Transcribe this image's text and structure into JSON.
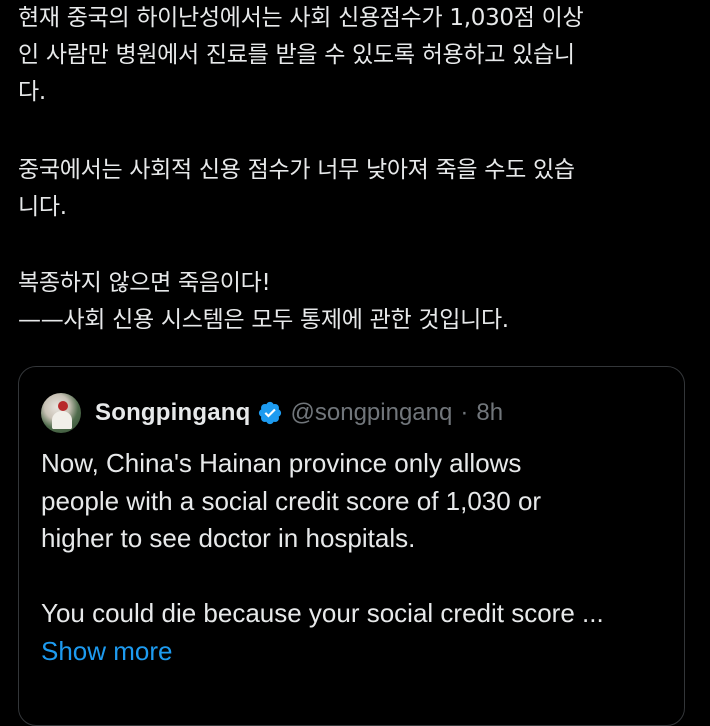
{
  "tweet": {
    "paragraphs": [
      {
        "lines": [
          "현재 중국의 하이난성에서는 사회 신용점수가 1,030점 이상",
          "인 사람만 병원에서 진료를 받을 수 있도록 허용하고 있습니",
          "다."
        ]
      },
      {
        "lines": [
          "중국에서는 사회적 신용 점수가 너무 낮아져 죽을 수도 있습",
          "니다."
        ]
      },
      {
        "lines": [
          "복종하지 않으면 죽음이다!",
          "——사회 신용 시스템은 모두 통제에 관한 것입니다."
        ]
      }
    ]
  },
  "quote": {
    "author_name": "Songpinganq",
    "handle": "@songpinganq",
    "separator": "·",
    "time": "8h",
    "verified_icon": "verified-badge-icon",
    "lines_1": [
      "Now, China's Hainan province only allows",
      "people with a social credit score of 1,030 or",
      "higher to see doctor in hospitals."
    ],
    "lines_2": [
      "You could die because your social credit score ..."
    ],
    "show_more_label": "Show more"
  },
  "colors": {
    "background": "#000000",
    "text": "#e7e9ea",
    "secondary": "#71767b",
    "link": "#1d9bf0",
    "border": "#333639",
    "verified": "#1d9bf0"
  }
}
